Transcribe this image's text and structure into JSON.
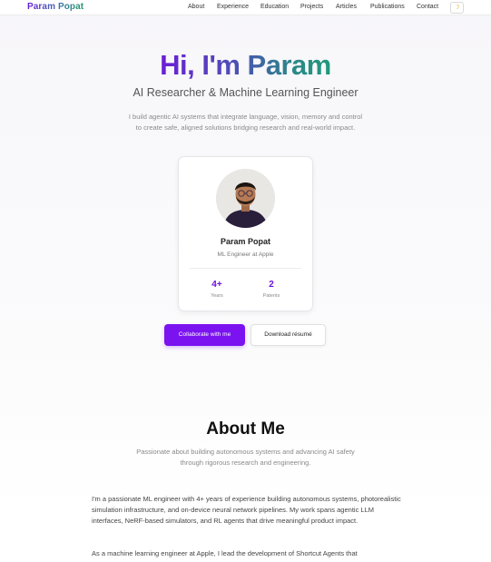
{
  "nav": {
    "brand": "Param Popat",
    "links": [
      "About",
      "Experience",
      "Education",
      "Projects",
      "Articles",
      "Publications",
      "Contact"
    ],
    "theme_icon": "moon-icon"
  },
  "hero": {
    "title": "Hi, I'm Param",
    "subtitle": "AI Researcher & Machine Learning Engineer",
    "description": "I build agentic AI systems that integrate language, vision, memory and control to create safe, aligned solutions bridging research and real-world impact."
  },
  "profile": {
    "name": "Param Popat",
    "role": "ML Engineer at Apple",
    "stats": [
      {
        "value": "4+",
        "label": "Years"
      },
      {
        "value": "2",
        "label": "Patents"
      }
    ]
  },
  "buttons": {
    "primary": "Collaborate with me",
    "secondary": "Download résumé"
  },
  "about": {
    "title": "About Me",
    "subtitle": "Passionate about building autonomous systems and advancing AI safety through rigorous research and engineering.",
    "paragraphs": [
      "I'm a passionate ML engineer with 4+ years of experience building autonomous systems, photorealistic simulation infrastructure, and on-device neural network pipelines. My work spans agentic LLM interfaces, NeRF-based simulators, and RL agents that drive meaningful product impact.",
      "As a machine learning engineer at Apple, I lead the development of Shortcut Agents that"
    ]
  },
  "colors": {
    "accent": "#7b12f0",
    "gradient_start": "#6b1ed6",
    "gradient_end": "#1f9a7a"
  }
}
